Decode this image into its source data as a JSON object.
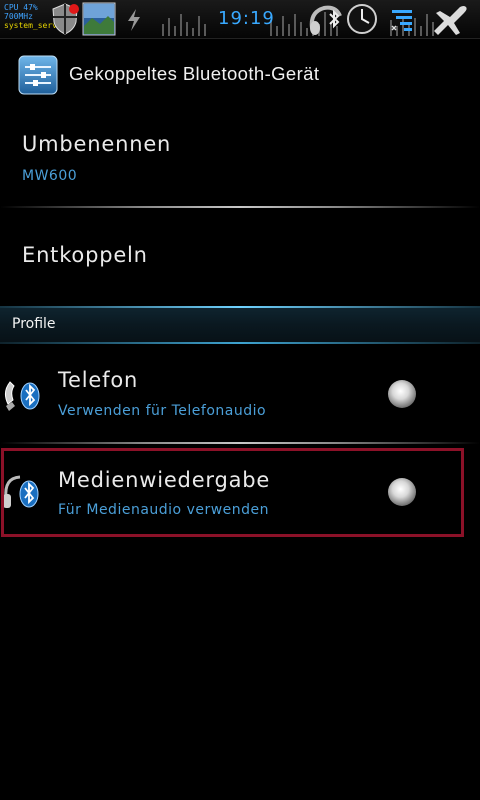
{
  "status_bar": {
    "cpu_line1": "CPU 47%",
    "cpu_line2": "700MHz",
    "process": "system_server",
    "time": "19:19",
    "icons": [
      "security-shield-icon",
      "photo-thumbnail-icon",
      "usb-icon",
      "bluetooth-headset-icon",
      "clock-icon",
      "signal-icon",
      "airplane-mode-icon"
    ]
  },
  "title_bar": {
    "title": "Gekoppeltes Bluetooth-Gerät",
    "icon": "settings-sliders-icon"
  },
  "rename": {
    "title": "Umbenennen",
    "value": "MW600"
  },
  "unpair": {
    "title": "Entkoppeln"
  },
  "profiles": {
    "header": "Profile",
    "items": [
      {
        "title": "Telefon",
        "subtitle": "Verwenden für Telefonaudio",
        "icon": "bluetooth-phone-icon",
        "checked": false
      },
      {
        "title": "Medienwiedergabe",
        "subtitle": "Für Medienaudio verwenden",
        "icon": "bluetooth-headphones-icon",
        "checked": false
      }
    ]
  },
  "colors": {
    "accent": "#39a9ff",
    "subtitle": "#4b9fd8",
    "highlight_border": "#8c1128",
    "background": "#000000"
  }
}
